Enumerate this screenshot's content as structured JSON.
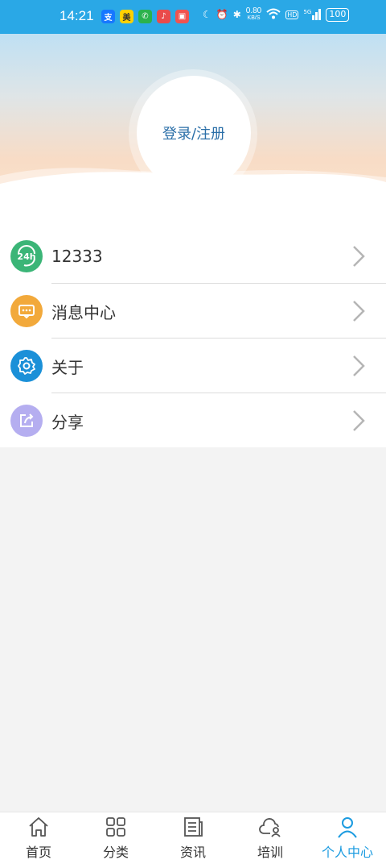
{
  "status_bar": {
    "time": "14:21",
    "net_speed_value": "0.80",
    "net_speed_unit": "KB/S",
    "hd_label": "HD",
    "signal_label": "5G",
    "battery": "100"
  },
  "header": {
    "login_label": "登录/注册"
  },
  "menu": [
    {
      "label": "12333",
      "icon": "24h-service-icon",
      "color": "#3bb577"
    },
    {
      "label": "消息中心",
      "icon": "message-icon",
      "color": "#f2a93b"
    },
    {
      "label": "关于",
      "icon": "gear-icon",
      "color": "#1b90d8"
    },
    {
      "label": "分享",
      "icon": "share-icon",
      "color": "#b5aef0"
    }
  ],
  "nav": [
    {
      "label": "首页",
      "icon": "home-icon"
    },
    {
      "label": "分类",
      "icon": "grid-icon"
    },
    {
      "label": "资讯",
      "icon": "news-icon"
    },
    {
      "label": "培训",
      "icon": "cloud-user-icon"
    },
    {
      "label": "个人中心",
      "icon": "person-icon",
      "active": true
    }
  ],
  "colors": {
    "accent": "#1b9be0",
    "status_bar": "#2aa8e6",
    "login_text": "#2b6fa8"
  }
}
